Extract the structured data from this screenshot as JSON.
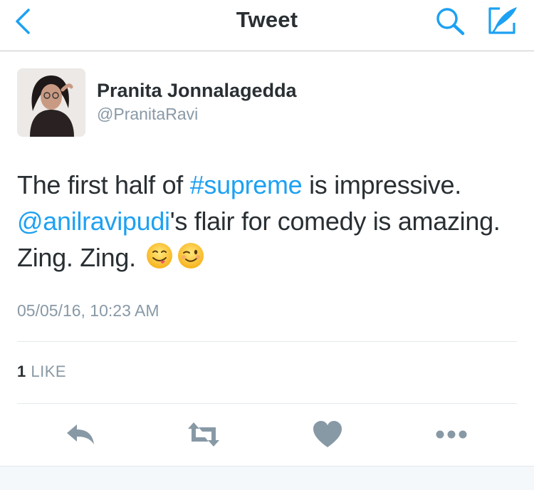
{
  "nav": {
    "title": "Tweet",
    "back_icon": "chevron-left-icon",
    "search_icon": "search-icon",
    "compose_icon": "compose-quill-icon",
    "accent_color": "#1da1f2"
  },
  "tweet": {
    "author": {
      "name": "Pranita Jonnalagedda",
      "handle": "@PranitaRavi",
      "avatar_icon": "profile-photo"
    },
    "text": {
      "part1": "The first half of ",
      "hashtag": "#supreme",
      "part2": " is impressive. ",
      "mention": "@anilravipudi",
      "part3": "'s flair for comedy is amazing. Zing. Zing. ",
      "emojis": [
        "face-savoring-food-emoji",
        "winking-face-emoji"
      ]
    },
    "timestamp": "05/05/16, 10:23 AM",
    "likes": {
      "count": "1",
      "label": " LIKE"
    }
  },
  "actions": [
    {
      "name": "reply-icon"
    },
    {
      "name": "retweet-icon"
    },
    {
      "name": "like-heart-icon"
    },
    {
      "name": "more-dots-icon"
    }
  ],
  "colors": {
    "text": "#292f33",
    "secondary": "#8899a6",
    "link": "#1da1f2",
    "action_icons": "#8899a6"
  }
}
